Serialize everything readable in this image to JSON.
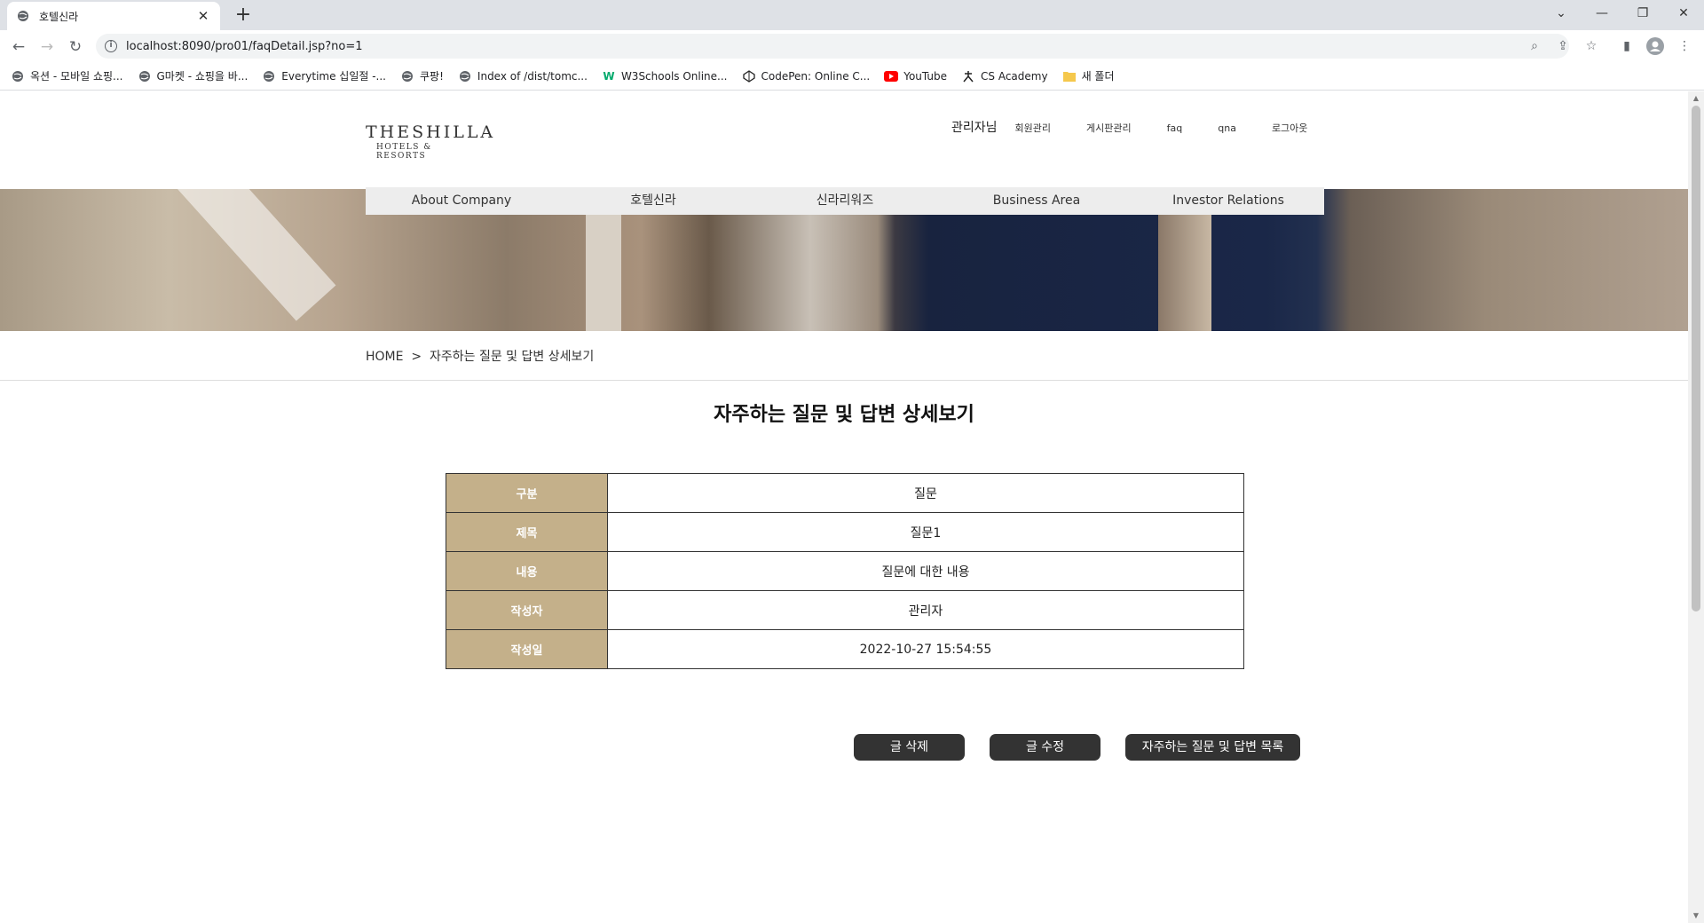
{
  "browser": {
    "tab_title": "호텔신라",
    "tab_close": "✕",
    "new_tab": "+",
    "url": "localhost:8090/pro01/faqDetail.jsp?no=1",
    "bookmarks": [
      {
        "label": "옥션 - 모바일 쇼핑...",
        "icon": "globe-icon"
      },
      {
        "label": "G마켓 - 쇼핑을 바...",
        "icon": "globe-icon"
      },
      {
        "label": "Everytime 십일절 -...",
        "icon": "globe-icon"
      },
      {
        "label": "쿠팡!",
        "icon": "globe-icon"
      },
      {
        "label": "Index of /dist/tomc...",
        "icon": "globe-icon"
      },
      {
        "label": "W3Schools Online...",
        "icon": "w3schools-icon"
      },
      {
        "label": "CodePen: Online C...",
        "icon": "codepen-icon"
      },
      {
        "label": "YouTube",
        "icon": "youtube-icon"
      },
      {
        "label": "CS Academy",
        "icon": "cs-academy-icon"
      },
      {
        "label": "새 폴더",
        "icon": "folder-icon"
      }
    ]
  },
  "site": {
    "logo_line1": "THESHILLA",
    "logo_line2": "HOTELS & RESORTS",
    "admin_label": "관리자님",
    "top_menu": [
      "회원관리",
      "게시판관리",
      "faq",
      "qna",
      "로그아웃"
    ],
    "main_nav": [
      "About Company",
      "호텔신라",
      "신라리워즈",
      "Business Area",
      "Investor Relations"
    ]
  },
  "breadcrumb": "HOME  >  자주하는 질문 및 답변 상세보기",
  "heading": "자주하는 질문 및 답변 상세보기",
  "detail": {
    "rows": [
      {
        "label": "구분",
        "value": "질문"
      },
      {
        "label": "제목",
        "value": "질문1"
      },
      {
        "label": "내용",
        "value": "질문에 대한 내용"
      },
      {
        "label": "작성자",
        "value": "관리자"
      },
      {
        "label": "작성일",
        "value": "2022-10-27 15:54:55"
      }
    ]
  },
  "buttons": {
    "delete": "글 삭제",
    "edit": "글 수정",
    "list": "자주하는 질문 및 답변 목록"
  },
  "colors": {
    "table_header": "#c4b08a",
    "button": "#333333",
    "nav_bar": "#ededed"
  }
}
